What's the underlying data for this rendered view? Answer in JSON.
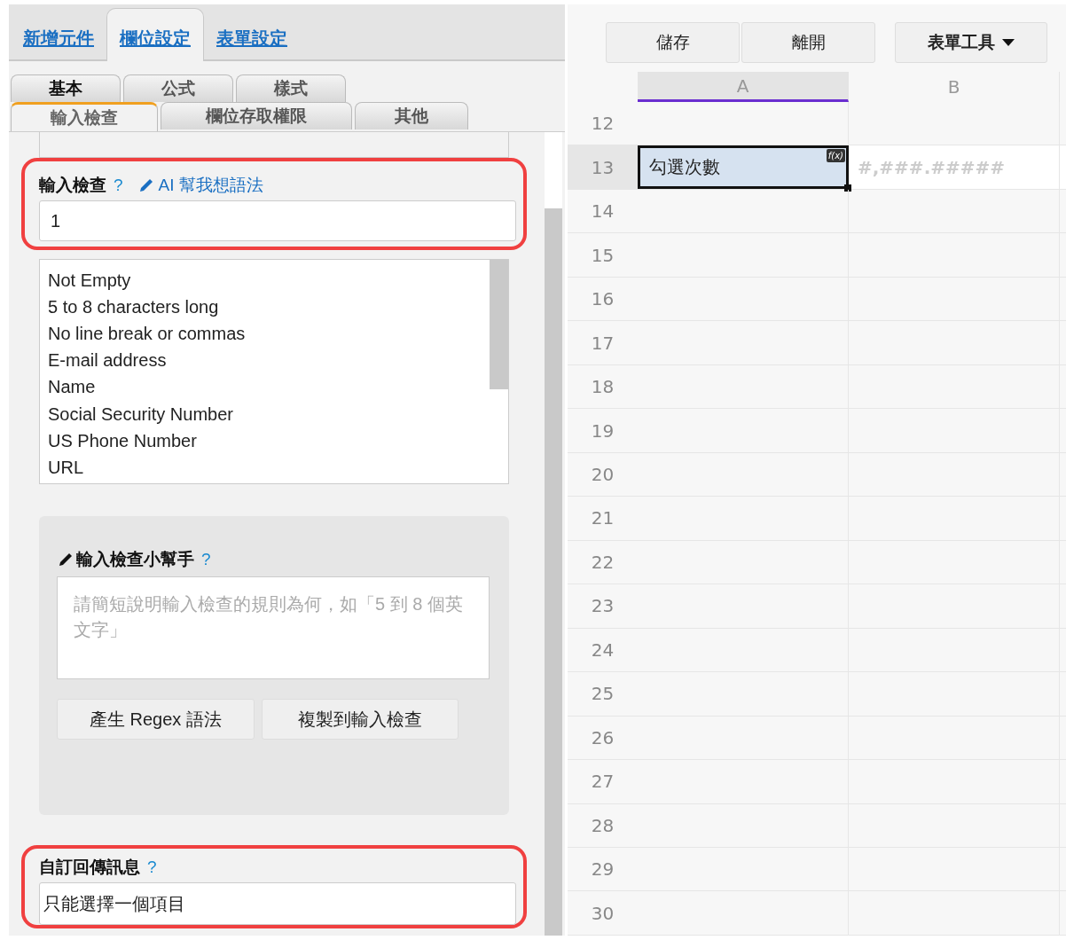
{
  "top_tabs": [
    {
      "label": "新增元件",
      "selected": false
    },
    {
      "label": "欄位設定",
      "selected": true
    },
    {
      "label": "表單設定",
      "selected": false
    }
  ],
  "sub_tabs_back": [
    {
      "label": "基本",
      "selected": false
    },
    {
      "label": "公式",
      "selected": false
    },
    {
      "label": "樣式",
      "selected": false
    }
  ],
  "sub_tabs_front": [
    {
      "label": "輸入檢查",
      "selected": true
    },
    {
      "label": "欄位存取權限",
      "selected": false
    },
    {
      "label": "其他",
      "selected": false
    }
  ],
  "validation": {
    "label": "輸入檢查",
    "help": "?",
    "ai_link": "AI 幫我想語法",
    "value": "1",
    "highlighted": true
  },
  "presets": [
    "Not Empty",
    "5 to 8 characters long",
    "No line break or commas",
    "E-mail address",
    "Name",
    "Social Security Number",
    "US Phone Number",
    "URL"
  ],
  "helper": {
    "title": "輸入檢查小幫手",
    "help": "?",
    "placeholder": "請簡短說明輸入檢查的規則為何，如「5 到 8 個英文字」",
    "buttons": [
      "產生 Regex 語法",
      "複製到輸入檢查"
    ]
  },
  "custom_message": {
    "label": "自訂回傳訊息",
    "help": "?",
    "value": "只能選擇一個項目",
    "highlighted": true
  },
  "toolbar": [
    {
      "label": "儲存",
      "kind": "plain"
    },
    {
      "label": "離開",
      "kind": "plain"
    },
    {
      "label": "表單工具",
      "kind": "dropdown"
    }
  ],
  "sheet": {
    "columns": [
      {
        "label": "A",
        "selected": true
      },
      {
        "label": "B",
        "selected": false
      }
    ],
    "rows": [
      {
        "number": "12",
        "selected": false,
        "cells": []
      },
      {
        "number": "13",
        "selected": true,
        "cells": [
          {
            "text": "勾選次數",
            "selected": true,
            "badge": "f(x)",
            "kind": "value"
          },
          {
            "text": "#,###.#####",
            "selected": false,
            "kind": "format"
          }
        ]
      },
      {
        "number": "14",
        "selected": false,
        "cells": []
      },
      {
        "number": "15",
        "selected": false,
        "cells": []
      },
      {
        "number": "16",
        "selected": false,
        "cells": []
      },
      {
        "number": "17",
        "selected": false,
        "cells": []
      },
      {
        "number": "18",
        "selected": false,
        "cells": []
      },
      {
        "number": "19",
        "selected": false,
        "cells": []
      },
      {
        "number": "20",
        "selected": false,
        "cells": []
      },
      {
        "number": "21",
        "selected": false,
        "cells": []
      },
      {
        "number": "22",
        "selected": false,
        "cells": []
      },
      {
        "number": "23",
        "selected": false,
        "cells": []
      },
      {
        "number": "24",
        "selected": false,
        "cells": []
      },
      {
        "number": "25",
        "selected": false,
        "cells": []
      },
      {
        "number": "26",
        "selected": false,
        "cells": []
      },
      {
        "number": "27",
        "selected": false,
        "cells": []
      },
      {
        "number": "28",
        "selected": false,
        "cells": []
      },
      {
        "number": "29",
        "selected": false,
        "cells": []
      },
      {
        "number": "30",
        "selected": false,
        "cells": []
      }
    ]
  }
}
